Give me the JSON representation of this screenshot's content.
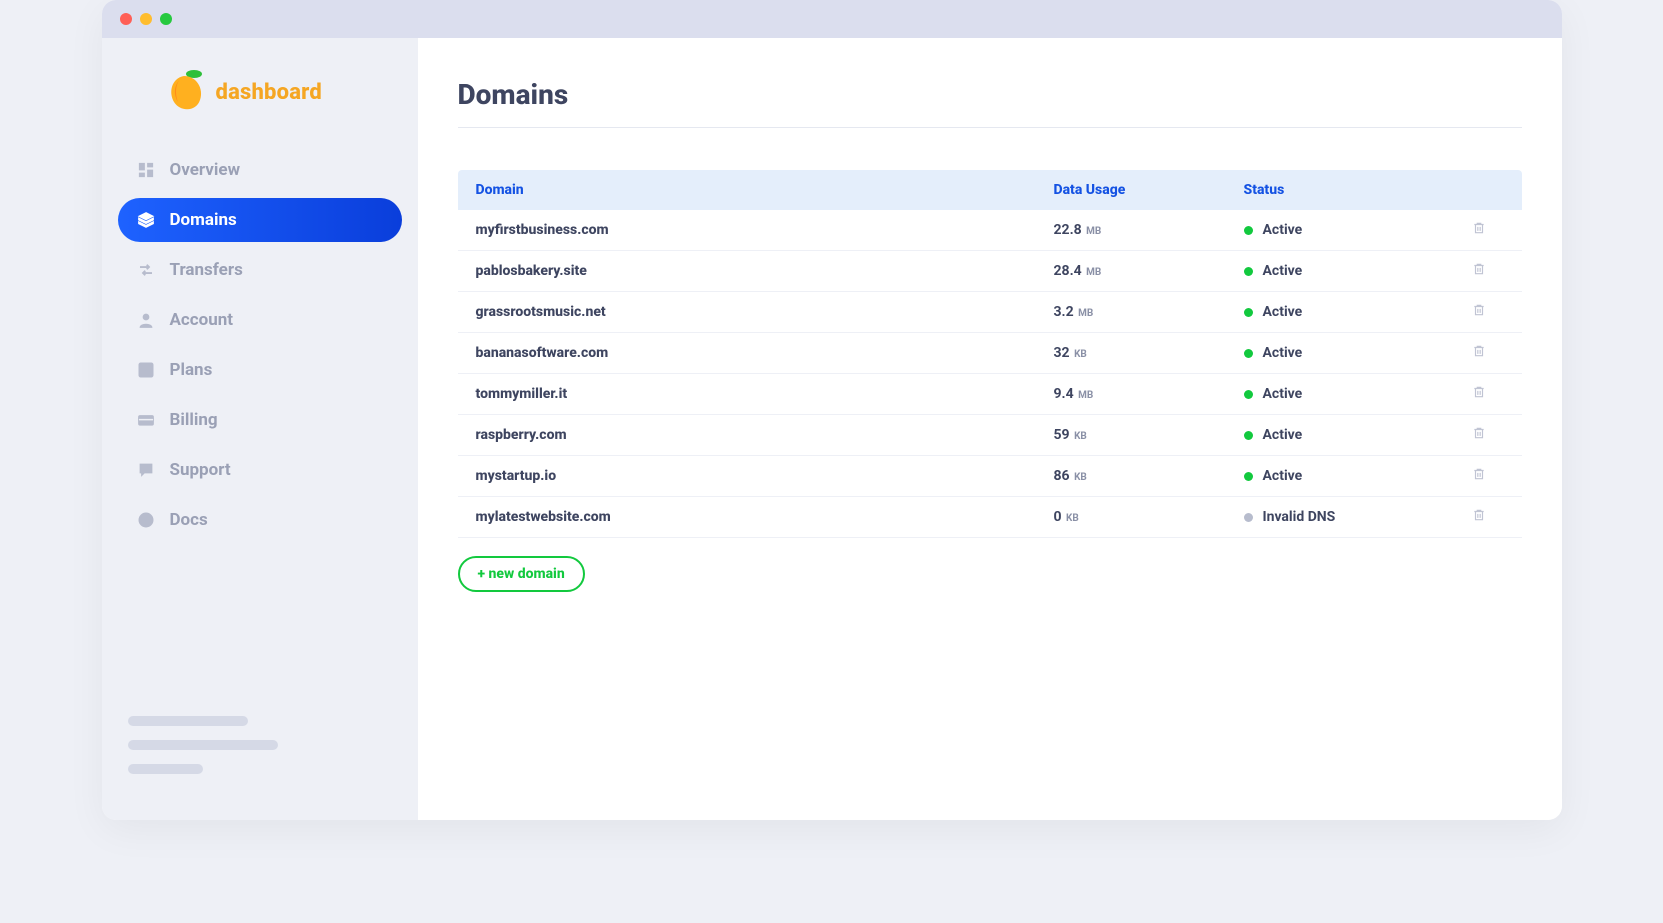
{
  "brand": {
    "name": "dashboard"
  },
  "nav": {
    "items": [
      {
        "label": "Overview",
        "active": false
      },
      {
        "label": "Domains",
        "active": true
      },
      {
        "label": "Transfers",
        "active": false
      },
      {
        "label": "Account",
        "active": false
      },
      {
        "label": "Plans",
        "active": false
      },
      {
        "label": "Billing",
        "active": false
      },
      {
        "label": "Support",
        "active": false
      },
      {
        "label": "Docs",
        "active": false
      }
    ]
  },
  "page": {
    "title": "Domains"
  },
  "table": {
    "headers": {
      "domain": "Domain",
      "usage": "Data Usage",
      "status": "Status"
    },
    "rows": [
      {
        "domain": "myfirstbusiness.com",
        "usage_value": "22.8",
        "usage_unit": "MB",
        "status": "Active",
        "status_kind": "active"
      },
      {
        "domain": "pablosbakery.site",
        "usage_value": "28.4",
        "usage_unit": "MB",
        "status": "Active",
        "status_kind": "active"
      },
      {
        "domain": "grassrootsmusic.net",
        "usage_value": "3.2",
        "usage_unit": "MB",
        "status": "Active",
        "status_kind": "active"
      },
      {
        "domain": "bananasoftware.com",
        "usage_value": "32",
        "usage_unit": "KB",
        "status": "Active",
        "status_kind": "active"
      },
      {
        "domain": "tommymiller.it",
        "usage_value": "9.4",
        "usage_unit": "MB",
        "status": "Active",
        "status_kind": "active"
      },
      {
        "domain": "raspberry.com",
        "usage_value": "59",
        "usage_unit": "KB",
        "status": "Active",
        "status_kind": "active"
      },
      {
        "domain": "mystartup.io",
        "usage_value": "86",
        "usage_unit": "KB",
        "status": "Active",
        "status_kind": "active"
      },
      {
        "domain": "mylatestwebsite.com",
        "usage_value": "0",
        "usage_unit": "KB",
        "status": "Invalid DNS",
        "status_kind": "invalid"
      }
    ]
  },
  "actions": {
    "new_domain": "+ new domain"
  }
}
